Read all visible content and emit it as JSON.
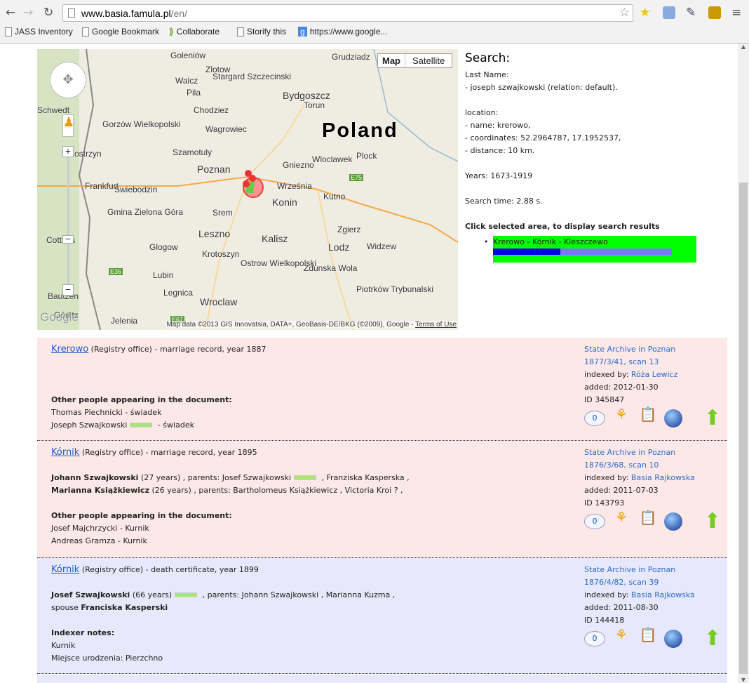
{
  "browser": {
    "url_host": "www.basia.famula.pl",
    "url_path": "/en/",
    "bookmarks": [
      "JASS Inventory",
      "Google Bookmark",
      "Collaborate",
      "Storify this",
      "https://www.google..."
    ]
  },
  "map": {
    "type_buttons": [
      "Map",
      "Satellite"
    ],
    "country": "Poland",
    "labels": [
      "Goleniów",
      "Grudziadz",
      "Stargard Szczecinski",
      "Zlotow",
      "Walcz",
      "Pila",
      "Bydgoszcz",
      "Torun",
      "Chodziez",
      "Schwedt",
      "Gorzów Wielkopolski",
      "Wagrowiec",
      "Kostrzyn",
      "Szamotuly",
      "Gniezno",
      "Wloclawek",
      "Plock",
      "Poznan",
      "Frankfurt",
      "Swiebodzin",
      "Września",
      "Kutno",
      "Konin",
      "Srem",
      "Gmina Zielona Góra",
      "Leszno",
      "Zgierz",
      "Glogow",
      "Kalisz",
      "Lodz",
      "Widzew",
      "Krotoszyn",
      "Ostrow Wielkopolski",
      "Zdunska Wola",
      "Lubin",
      "Piotrków Trybunalski",
      "Legnica",
      "Wroclaw",
      "Jelenia",
      "Görlitz",
      "Cottbus",
      "Bautzen",
      "E75",
      "E36",
      "E67"
    ],
    "attribution": "Map data ©2013 GIS Innovatsia, DATA+, GeoBasis-DE/BKG (©2009), Google - ",
    "terms": "Terms of Use",
    "google_logo": "Google"
  },
  "search": {
    "heading": "Search:",
    "lines": [
      "Last Name:",
      "- joseph szwajkowski (relation: default).",
      "",
      "location:",
      "- name: krerowo,",
      "- coordinates: 52.2964787, 17.1952537,",
      "- distance: 10 km.",
      "",
      "Years: 1673-1919",
      "",
      "Search time: 2.88 s.",
      ""
    ],
    "click_hint": "Click selected area, to display search results",
    "result_area": "Krerowo - Kórnik - Kleszczewo",
    "area_highlight": "#00ff00"
  },
  "records": [
    {
      "place": "Krerowo",
      "desc": " (Registry office) - marriage record, year 1887",
      "bg": "#fde8e8",
      "other_heading": "Other people appearing in the document:",
      "others": [
        "Thomas Piechnicki - świadek",
        "Joseph Szwajkowski"
      ],
      "other2_suffix": " - świadek",
      "archive": "State Archive in Poznan",
      "signature": "1877/3/41, scan 13",
      "indexed_label": "indexed by: ",
      "indexer": "Róża Lewicz",
      "added": "added: 2012-01-30",
      "id": "ID 345847",
      "comments": "0"
    },
    {
      "place": "Kórnik",
      "desc": " (Registry office) - marriage record, year 1895",
      "bg": "#fde8e8",
      "p1": "Johann Szwajkowski",
      "p1_age": " (27 years) , parents: Josef Szwajkowski",
      "p1_rest": " , Franziska Kasperska ,",
      "p2": "Marianna Książkiewicz",
      "p2_rest": " (26 years) , parents: Bartholomeus Książkiewicz , Victoria Kroi ? ,",
      "other_heading": "Other people appearing in the document:",
      "others": [
        "Josef Majchrzycki - Kurnik",
        "Andreas Gramza - Kurnik"
      ],
      "archive": "State Archive in Poznan",
      "signature": "1876/3/68, scan 10",
      "indexed_label": "indexed by: ",
      "indexer": "Basia Rajkowska",
      "added": "added: 2011-07-03",
      "id": "ID 143793",
      "comments": "0"
    },
    {
      "place": "Kórnik",
      "desc": " (Registry office) - death certificate, year 1899",
      "bg": "#e8e8fc",
      "p1": "Josef Szwajkowski",
      "p1_age": " (66 years)",
      "p1_rest": " , parents: Johann Szwajkowski , Marianna Kuzma ,",
      "spouse_label": "spouse ",
      "spouse": "Franciska Kasperski",
      "notes_heading": "Indexer notes:",
      "notes": [
        "Kurnik",
        "Miejsce urodzenia: Pierzchno"
      ],
      "archive": "State Archive in Poznan",
      "signature": "1876/4/82, scan 39",
      "indexed_label": "indexed by: ",
      "indexer": "Basia Rajkowska",
      "added": "added: 2011-08-30",
      "id": "ID 144418",
      "comments": "0"
    }
  ]
}
